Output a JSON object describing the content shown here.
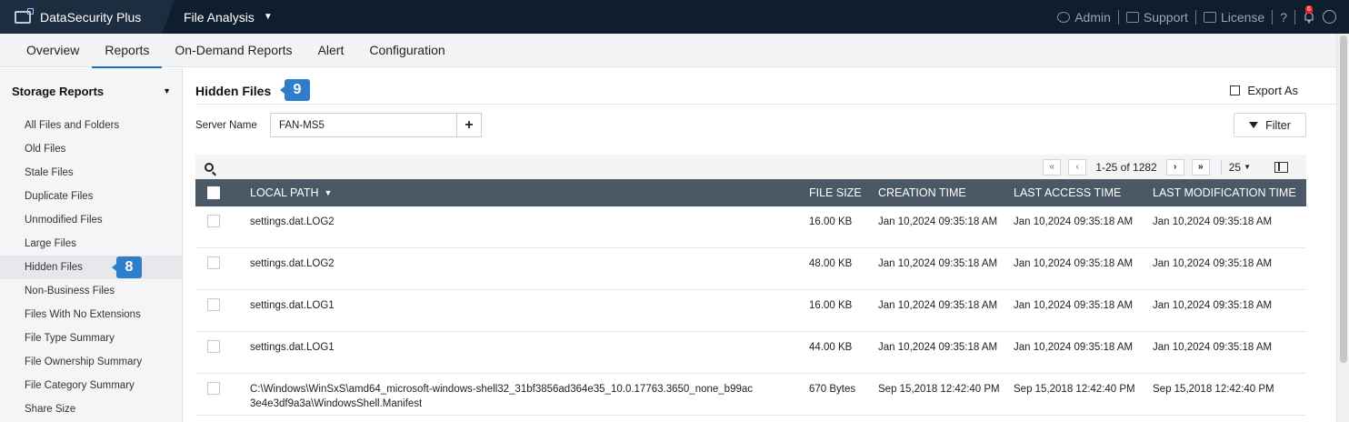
{
  "app": {
    "brand": "DataSecurity Plus",
    "module": "File Analysis",
    "top_links": {
      "admin": "Admin",
      "support": "Support",
      "license": "License",
      "help": "?",
      "notification_count": "6"
    }
  },
  "nav": {
    "tabs": [
      "Overview",
      "Reports",
      "On-Demand Reports",
      "Alert",
      "Configuration"
    ],
    "active": "Reports"
  },
  "sidebar": {
    "section": "Storage Reports",
    "items": [
      "All Files and Folders",
      "Old Files",
      "Stale Files",
      "Duplicate Files",
      "Unmodified Files",
      "Large Files",
      "Hidden Files",
      "Non-Business Files",
      "Files With No Extensions",
      "File Type Summary",
      "File Ownership Summary",
      "File Category Summary",
      "Share Size"
    ],
    "active_index": 6,
    "step_badge": "8"
  },
  "main": {
    "title": "Hidden Files",
    "step_badge": "9",
    "export_label": "Export As",
    "server_label": "Server Name",
    "server_value": "FAN-MS5",
    "filter_label": "Filter",
    "pager": {
      "range": "1-25 of 1282",
      "page_size": "25"
    },
    "columns": [
      "LOCAL PATH",
      "FILE SIZE",
      "CREATION TIME",
      "LAST ACCESS TIME",
      "LAST MODIFICATION TIME"
    ],
    "rows": [
      {
        "path": "settings.dat.LOG2",
        "size": "16.00 KB",
        "created": "Jan 10,2024 09:35:18 AM",
        "accessed": "Jan 10,2024 09:35:18 AM",
        "modified": "Jan 10,2024 09:35:18 AM"
      },
      {
        "path": "settings.dat.LOG2",
        "size": "48.00 KB",
        "created": "Jan 10,2024 09:35:18 AM",
        "accessed": "Jan 10,2024 09:35:18 AM",
        "modified": "Jan 10,2024 09:35:18 AM"
      },
      {
        "path": "settings.dat.LOG1",
        "size": "16.00 KB",
        "created": "Jan 10,2024 09:35:18 AM",
        "accessed": "Jan 10,2024 09:35:18 AM",
        "modified": "Jan 10,2024 09:35:18 AM"
      },
      {
        "path": "settings.dat.LOG1",
        "size": "44.00 KB",
        "created": "Jan 10,2024 09:35:18 AM",
        "accessed": "Jan 10,2024 09:35:18 AM",
        "modified": "Jan 10,2024 09:35:18 AM"
      },
      {
        "path": "C:\\Windows\\WinSxS\\amd64_microsoft-windows-shell32_31bf3856ad364e35_10.0.17763.3650_none_b99ac3e4e3df9a3a\\WindowsShell.Manifest",
        "size": "670 Bytes",
        "created": "Sep 15,2018 12:42:40 PM",
        "accessed": "Sep 15,2018 12:42:40 PM",
        "modified": "Sep 15,2018 12:42:40 PM"
      }
    ]
  }
}
